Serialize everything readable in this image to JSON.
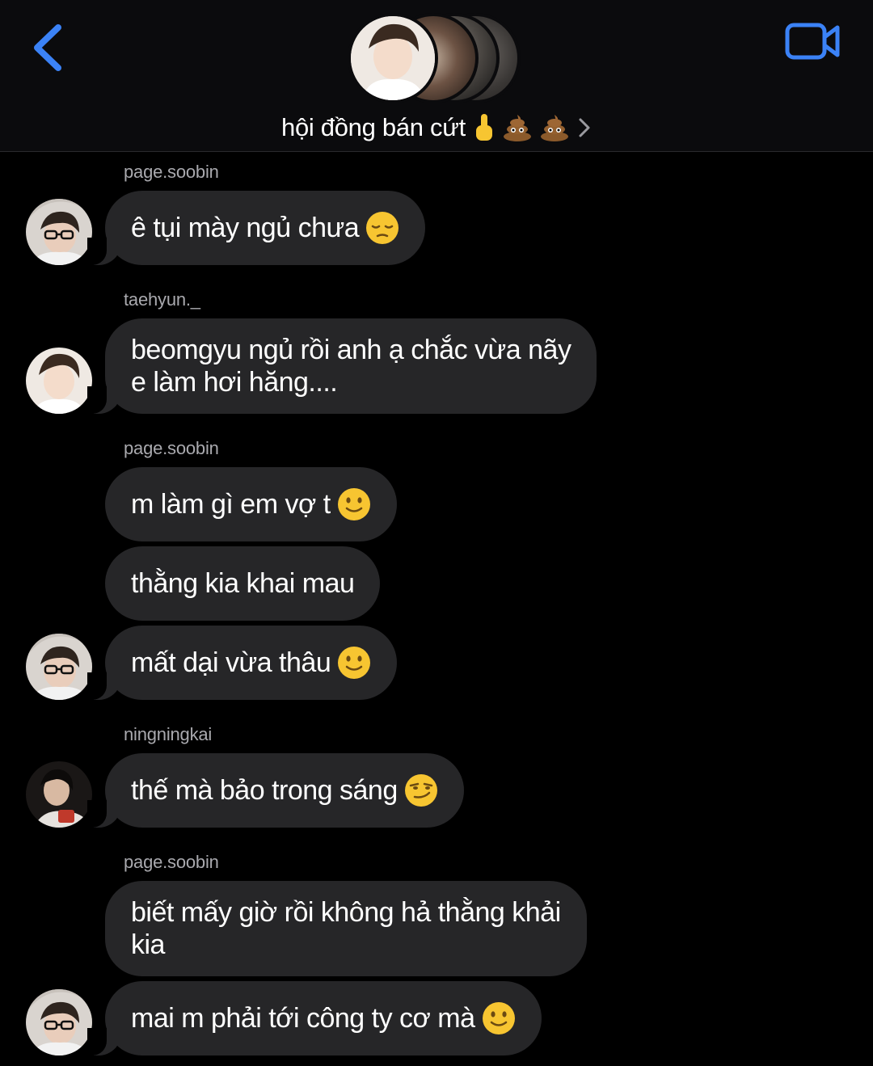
{
  "header": {
    "group_title": "hội đồng bán cứt"
  },
  "messages": [
    {
      "sender": "page.soobin",
      "text": "ê tụi mày ngủ chưa",
      "emoji": "pensive-face"
    },
    {
      "sender": "taehyun._",
      "line1": "beomgyu ngủ rồi anh ạ chắc vừa nãy",
      "line2": "e làm hơi hăng...."
    },
    {
      "sender": "page.soobin",
      "text": "m làm gì em vợ t",
      "emoji": "slightly-smiling-face"
    },
    {
      "text": "thằng kia khai mau"
    },
    {
      "text": "mất dại vừa thâu",
      "emoji": "slightly-smiling-face"
    },
    {
      "sender": "ningningkai",
      "text": "thế mà bảo trong sáng",
      "emoji": "smirking-face"
    },
    {
      "sender": "page.soobin",
      "line1": "biết mấy giờ rồi không hả thằng khải",
      "line2": "kia"
    },
    {
      "text": "mai m phải tới công ty cơ mà",
      "emoji": "slightly-smiling-face"
    }
  ],
  "colors": {
    "accent_blue": "#3b82f6",
    "bubble_bg": "#262628",
    "sender_text": "#a9a9ae",
    "emoji_yellow": "#f7c531",
    "poop_brown": "#8b5a2b"
  },
  "icons": [
    "back-chevron-icon",
    "video-call-icon",
    "middle-finger-emoji",
    "poop-emoji",
    "chevron-right-icon"
  ]
}
